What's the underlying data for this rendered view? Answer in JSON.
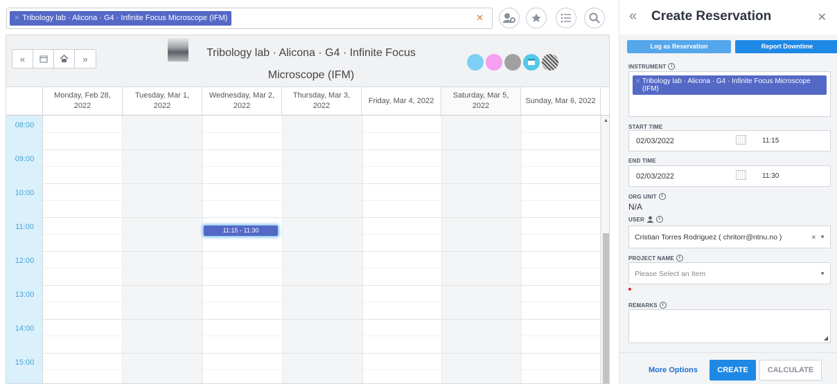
{
  "search": {
    "tag_label": "Tribology lab · Alicona · G4 · Infinite Focus Microscope (IFM)",
    "clear_icon": "clear-x-icon"
  },
  "toolbar": {
    "icons": [
      "user-settings-icon",
      "star-icon",
      "list-icon",
      "search-icon"
    ]
  },
  "calendar": {
    "nav": [
      "double-chevron-left-icon",
      "calendar-icon",
      "home-icon",
      "double-chevron-right-icon"
    ],
    "title": "Tribology lab · Alicona · G4 · Infinite Focus Microscope (IFM)",
    "legend_colors": [
      "#7dd0f5",
      "#f69ef0",
      "#a0a0a0",
      "#54c8e8",
      "hatched"
    ],
    "days": [
      "Monday, Feb 28, 2022",
      "Tuesday, Mar 1, 2022",
      "Wednesday, Mar 2, 2022",
      "Thursday, Mar 3, 2022",
      "Friday, Mar 4, 2022",
      "Saturday, Mar 5, 2022",
      "Sunday, Mar 6, 2022"
    ],
    "times": [
      "08:00",
      "09:00",
      "10:00",
      "11:00",
      "12:00",
      "13:00",
      "14:00",
      "15:00"
    ],
    "reservation": {
      "label": "11:15 - 11:30",
      "day": "Wednesday, Mar 2, 2022",
      "start": "11:15",
      "end": "11:30"
    }
  },
  "panel": {
    "title": "Create Reservation",
    "log_btn": "Log as Reservation",
    "downtime_btn": "Report Downtime",
    "instrument_label": "INSTRUMENT",
    "instrument_value": "Tribology lab · Alicona · G4 · Infinite Focus Microscope (IFM)",
    "start_label": "START TIME",
    "start_date": "02/03/2022",
    "start_time": "11:15",
    "end_label": "END TIME",
    "end_date": "02/03/2022",
    "end_time": "11:30",
    "org_label": "ORG UNIT",
    "org_value": "N/A",
    "user_label": "USER",
    "user_value": "Cristian Torres Rodriguez ( chritorr@ntnu.no )",
    "project_label": "PROJECT NAME",
    "project_placeholder": "Please Select an Item",
    "remarks_label": "REMARKS",
    "more_options": "More Options",
    "create": "CREATE",
    "calculate": "CALCULATE"
  },
  "colors": {
    "accent": "#1e88e5",
    "tag": "#5468c6",
    "time_gutter": "#daf0fb"
  }
}
